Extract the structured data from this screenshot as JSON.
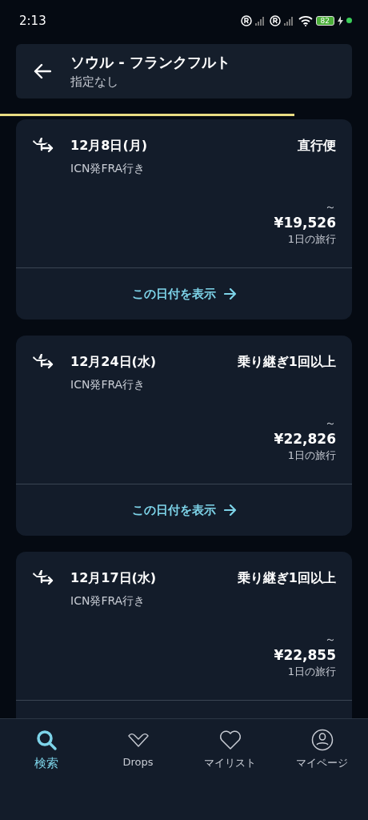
{
  "status_bar": {
    "time": "2:13",
    "battery": "82"
  },
  "header": {
    "title": "ソウル - フランクフルト",
    "subtitle": "指定なし"
  },
  "results": [
    {
      "date": "12月8日(月)",
      "stops": "直行便",
      "route": "ICN発FRA行き",
      "price_prefix": "～",
      "price": "¥19,526",
      "trip": "1日の旅行",
      "action": "この日付を表示"
    },
    {
      "date": "12月24日(水)",
      "stops": "乗り継ぎ1回以上",
      "route": "ICN発FRA行き",
      "price_prefix": "～",
      "price": "¥22,826",
      "trip": "1日の旅行",
      "action": "この日付を表示"
    },
    {
      "date": "12月17日(水)",
      "stops": "乗り継ぎ1回以上",
      "route": "ICN発FRA行き",
      "price_prefix": "～",
      "price": "¥22,855",
      "trip": "1日の旅行"
    }
  ],
  "tab_bar": [
    {
      "kind": "search",
      "label": "検索",
      "selected": true
    },
    {
      "kind": "drops",
      "label": "Drops",
      "selected": false
    },
    {
      "kind": "list",
      "label": "マイリスト",
      "selected": false
    },
    {
      "kind": "profile",
      "label": "マイページ",
      "selected": false
    }
  ]
}
